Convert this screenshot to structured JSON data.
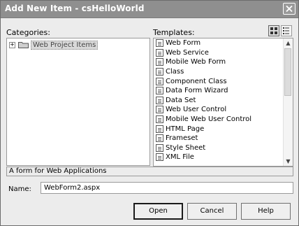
{
  "window": {
    "title": "Add New Item - csHelloWorld"
  },
  "categories": {
    "label": "Categories:",
    "items": [
      {
        "label": "Web Project Items",
        "selected": true
      }
    ]
  },
  "templates": {
    "label": "Templates:",
    "items": [
      {
        "label": "Web Form",
        "icon": "web-form-icon"
      },
      {
        "label": "Web Service",
        "icon": "web-service-icon"
      },
      {
        "label": "Mobile Web Form",
        "icon": "mobile-web-form-icon"
      },
      {
        "label": "Class",
        "icon": "class-icon"
      },
      {
        "label": "Component Class",
        "icon": "component-class-icon"
      },
      {
        "label": "Data Form Wizard",
        "icon": "data-form-wizard-icon"
      },
      {
        "label": "Data Set",
        "icon": "data-set-icon"
      },
      {
        "label": "Web User Control",
        "icon": "web-user-control-icon"
      },
      {
        "label": "Mobile Web User Control",
        "icon": "mobile-web-user-control-icon"
      },
      {
        "label": "HTML Page",
        "icon": "html-page-icon"
      },
      {
        "label": "Frameset",
        "icon": "frameset-icon"
      },
      {
        "label": "Style Sheet",
        "icon": "style-sheet-icon"
      },
      {
        "label": "XML File",
        "icon": "xml-file-icon"
      }
    ]
  },
  "description": "A form for Web Applications",
  "name_field": {
    "label": "Name:",
    "value": "WebForm2.aspx"
  },
  "buttons": {
    "open": "Open",
    "cancel": "Cancel",
    "help": "Help"
  }
}
